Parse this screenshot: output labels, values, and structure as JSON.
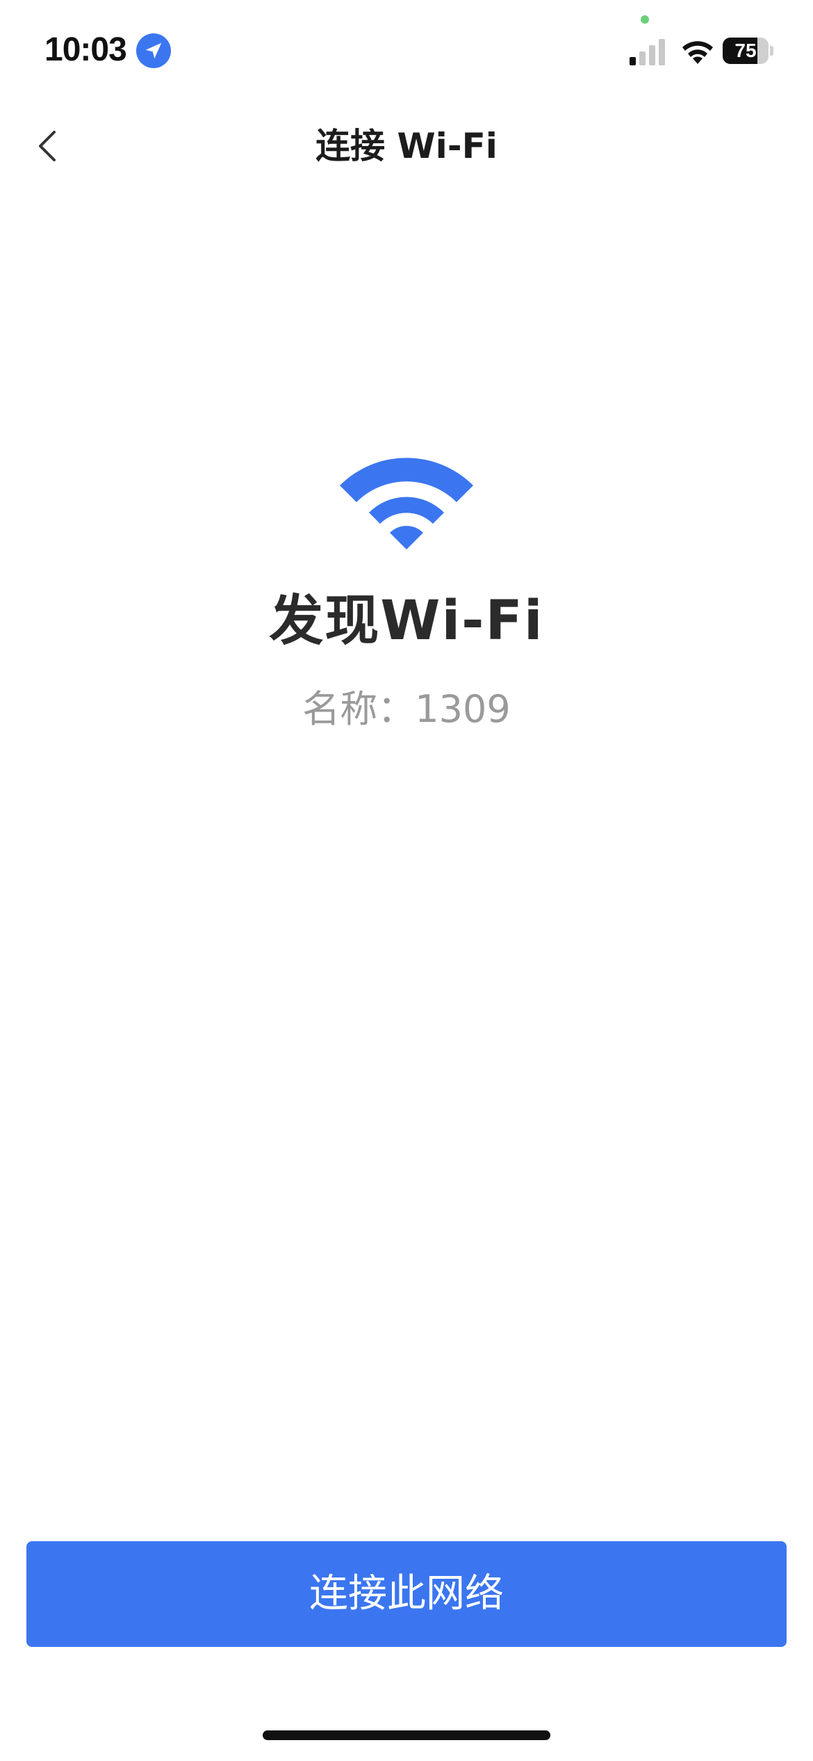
{
  "status_bar": {
    "time": "10:03",
    "battery_level": "75",
    "battery_fraction": 0.75
  },
  "nav": {
    "title": "连接 Wi-Fi"
  },
  "main": {
    "heading": "发现Wi-Fi",
    "network_name": "名称：1309"
  },
  "actions": {
    "connect_label": "连接此网络"
  },
  "colors": {
    "accent": "#3b76f0",
    "title_text": "#2b2b2b",
    "secondary_text": "#9a9a9a"
  },
  "icons": {
    "back": "chevron-left-icon",
    "wifi": "wifi-icon",
    "location": "location-arrow-icon",
    "signal": "cellular-signal-icon",
    "battery": "battery-icon"
  }
}
